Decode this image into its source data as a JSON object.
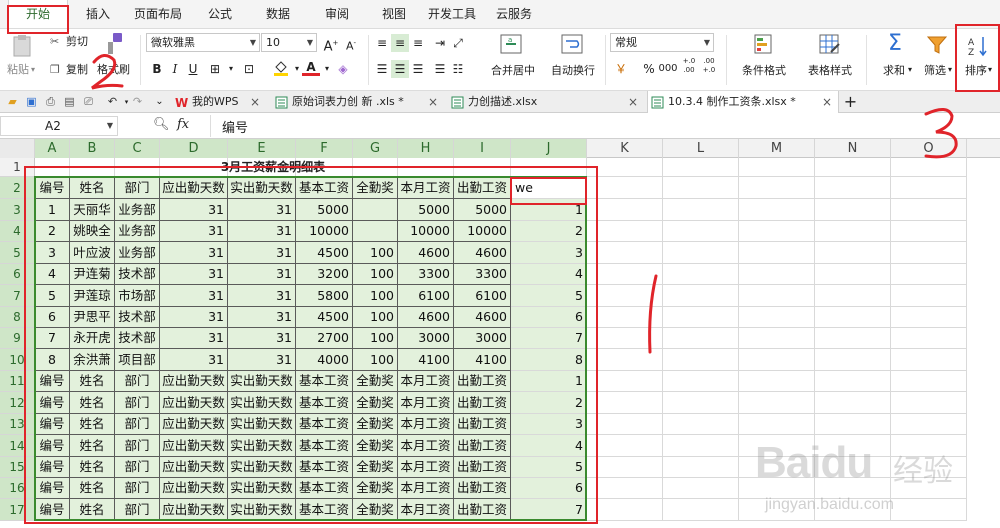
{
  "menu": {
    "tabs": [
      "开始",
      "插入",
      "页面布局",
      "公式",
      "数据",
      "审阅",
      "视图",
      "开发工具",
      "云服务"
    ]
  },
  "ribbon": {
    "paste_label": "粘贴",
    "cut_label": "剪切",
    "copy_label": "复制",
    "format_painter_label": "格式刷",
    "font_name": "微软雅黑",
    "font_size": "10",
    "merge_label": "合并居中",
    "wrap_label": "自动换行",
    "number_format": "常规",
    "conditional_format_label": "条件格式",
    "table_style_label": "表格样式",
    "sum_label": "求和",
    "filter_label": "筛选",
    "sort_label": "排序",
    "percent": "%",
    "thousands": "000",
    "inc_decimal": "+.0\n.00",
    "dec_decimal": ".00\n+.0"
  },
  "doc_tabs": [
    {
      "label": "我的WPS",
      "active": false
    },
    {
      "label": "原始词表力创 新 .xls *",
      "active": false
    },
    {
      "label": "力创描述.xlsx",
      "active": false
    },
    {
      "label": "10.3.4 制作工资条.xlsx *",
      "active": true
    }
  ],
  "formula_bar": {
    "cell_ref": "A2",
    "fx": "fx",
    "content": "编号"
  },
  "grid": {
    "columns": [
      "A",
      "B",
      "C",
      "D",
      "E",
      "F",
      "G",
      "H",
      "I",
      "J",
      "K",
      "L",
      "M",
      "N",
      "O"
    ],
    "rows": [
      "1",
      "2",
      "3",
      "4",
      "5",
      "6",
      "7",
      "8",
      "9",
      "10",
      "11",
      "12",
      "13",
      "14",
      "15",
      "16",
      "17"
    ],
    "title": "3月工资薪金明细表",
    "header": [
      "编号",
      "姓名",
      "部门",
      "应出勤天数",
      "实出勤天数",
      "基本工资",
      "全勤奖",
      "本月工资",
      "出勤工资",
      "we"
    ],
    "data": [
      [
        "1",
        "天丽华",
        "业务部",
        "31",
        "31",
        "5000",
        "",
        "5000",
        "5000",
        "1"
      ],
      [
        "2",
        "姚映全",
        "业务部",
        "31",
        "31",
        "10000",
        "",
        "10000",
        "10000",
        "2"
      ],
      [
        "3",
        "叶应波",
        "业务部",
        "31",
        "31",
        "4500",
        "100",
        "4600",
        "4600",
        "3"
      ],
      [
        "4",
        "尹连菊",
        "技术部",
        "31",
        "31",
        "3200",
        "100",
        "3300",
        "3300",
        "4"
      ],
      [
        "5",
        "尹莲琼",
        "市场部",
        "31",
        "31",
        "5800",
        "100",
        "6100",
        "6100",
        "5"
      ],
      [
        "6",
        "尹思平",
        "技术部",
        "31",
        "31",
        "4500",
        "100",
        "4600",
        "4600",
        "6"
      ],
      [
        "7",
        "永开虎",
        "技术部",
        "31",
        "31",
        "2700",
        "100",
        "3000",
        "3000",
        "7"
      ],
      [
        "8",
        "余洪萧",
        "项目部",
        "31",
        "31",
        "4000",
        "100",
        "4100",
        "4100",
        "8"
      ]
    ],
    "repeat_header": [
      "编号",
      "姓名",
      "部门",
      "应出勤天数",
      "实出勤天数",
      "基本工资",
      "全勤奖",
      "本月工资",
      "出勤工资"
    ],
    "repeat_numbers": [
      "1",
      "2",
      "3",
      "4",
      "5",
      "6",
      "7"
    ]
  },
  "annotations": {
    "num1": "1",
    "num2": "2",
    "num3": "3"
  },
  "watermark": {
    "brand": "Baidu",
    "cn": "经验",
    "url": "jingyan.baidu.com"
  },
  "colors": {
    "accent": "#3a8a2e",
    "annotation_red": "#e0242a",
    "selection_fill": "#e3f1dc"
  }
}
